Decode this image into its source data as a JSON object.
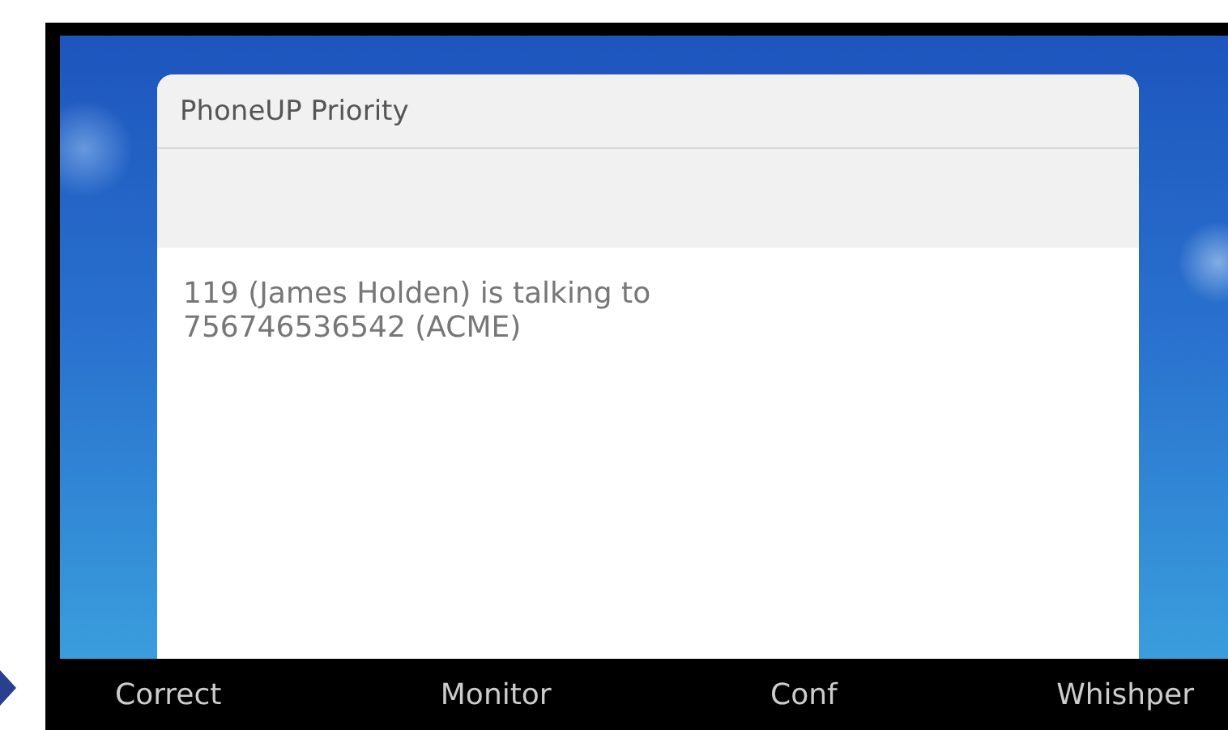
{
  "dialog": {
    "title": "PhoneUP Priority",
    "message": "119 (James Holden) is talking to 756746536542 (ACME)"
  },
  "softkeys": [
    "Correct",
    "Monitor",
    "Conf",
    "Whishper"
  ]
}
